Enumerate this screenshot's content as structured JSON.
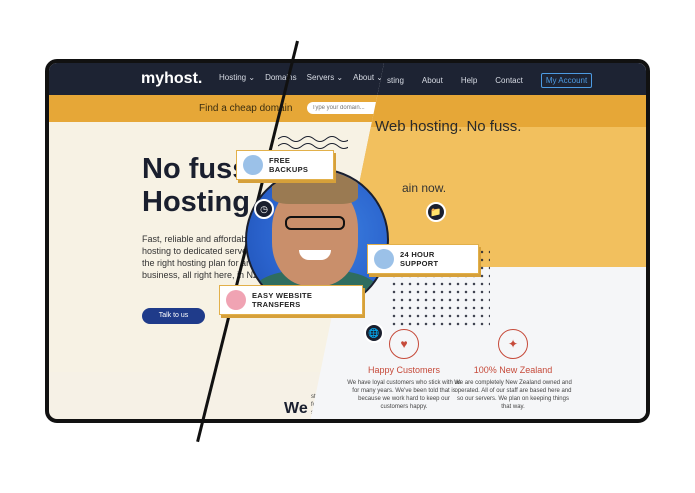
{
  "nav": {
    "logo": "myhost.",
    "left_items": [
      "Hosting ⌄",
      "Domains",
      "Servers ⌄",
      "About ⌄"
    ],
    "right_items": [
      "sting",
      "About",
      "Help",
      "Contact"
    ],
    "account_button": "My Account"
  },
  "domain_bar": {
    "label": "Find a cheap domain",
    "placeholder": "Type your domain..."
  },
  "hero": {
    "headline": "No fuss Hosting",
    "copy": "Fast, reliable and affordable. From Web hosting to dedicated servers, MyHost has the right hosting plan for any sized business, all right here, in NZ.",
    "cta": "Talk to us",
    "right_tagline": "Web hosting. No fuss.",
    "right_subtag": "ain now."
  },
  "badges": {
    "backups": "FREE BACKUPS",
    "support": "24 HOUR SUPPORT",
    "transfers": "EASY WEBSITE TRANSFERS"
  },
  "features": [
    {
      "title": "Happy Customers",
      "text": "We have loyal customers who stick with us for many years. We've been told that is because we work hard to keep our customers happy."
    },
    {
      "title": "100% New Zealand",
      "text": "We are completely New Zealand owned and operated. All of our staff are based here and so our servers. We plan on keeping things that way."
    }
  ],
  "bottom": {
    "we_heading": "We",
    "snippet": "sting since for those uld say we doing"
  }
}
